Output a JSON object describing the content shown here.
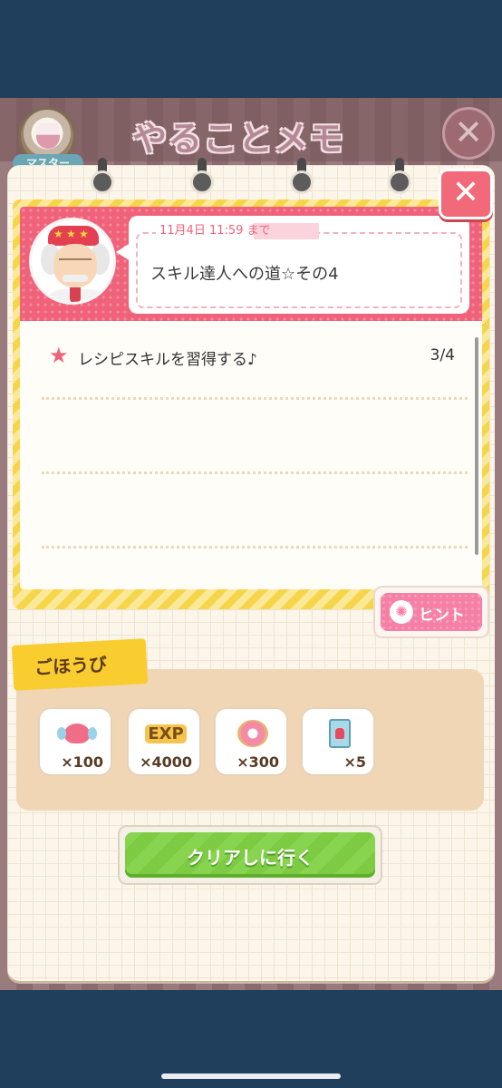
{
  "header": {
    "title": "やることメモ",
    "master_label": "マスター",
    "close_icon": "close-icon"
  },
  "mission": {
    "deadline": "11月4日 11:59 まで",
    "title": "スキル達人への道☆その4",
    "tasks": [
      {
        "label": "レシピスキルを習得する♪",
        "progress": "3/4"
      }
    ]
  },
  "hint": {
    "label": "ヒント",
    "icon": "lightbulb-icon"
  },
  "rewards": {
    "title": "ごほうび",
    "items": [
      {
        "icon": "heart-wings-icon",
        "count": "×100"
      },
      {
        "icon": "exp-icon",
        "icon_text": "EXP",
        "count": "×4000"
      },
      {
        "icon": "donut-icon",
        "count": "×300"
      },
      {
        "icon": "card-icon",
        "count": "×5"
      }
    ]
  },
  "action": {
    "label": "クリアしに行く"
  },
  "colors": {
    "accent_pink": "#f0627a",
    "stripe_yellow": "#f7d54a",
    "button_green": "#88d34f",
    "reward_panel": "#f1d6b6"
  }
}
